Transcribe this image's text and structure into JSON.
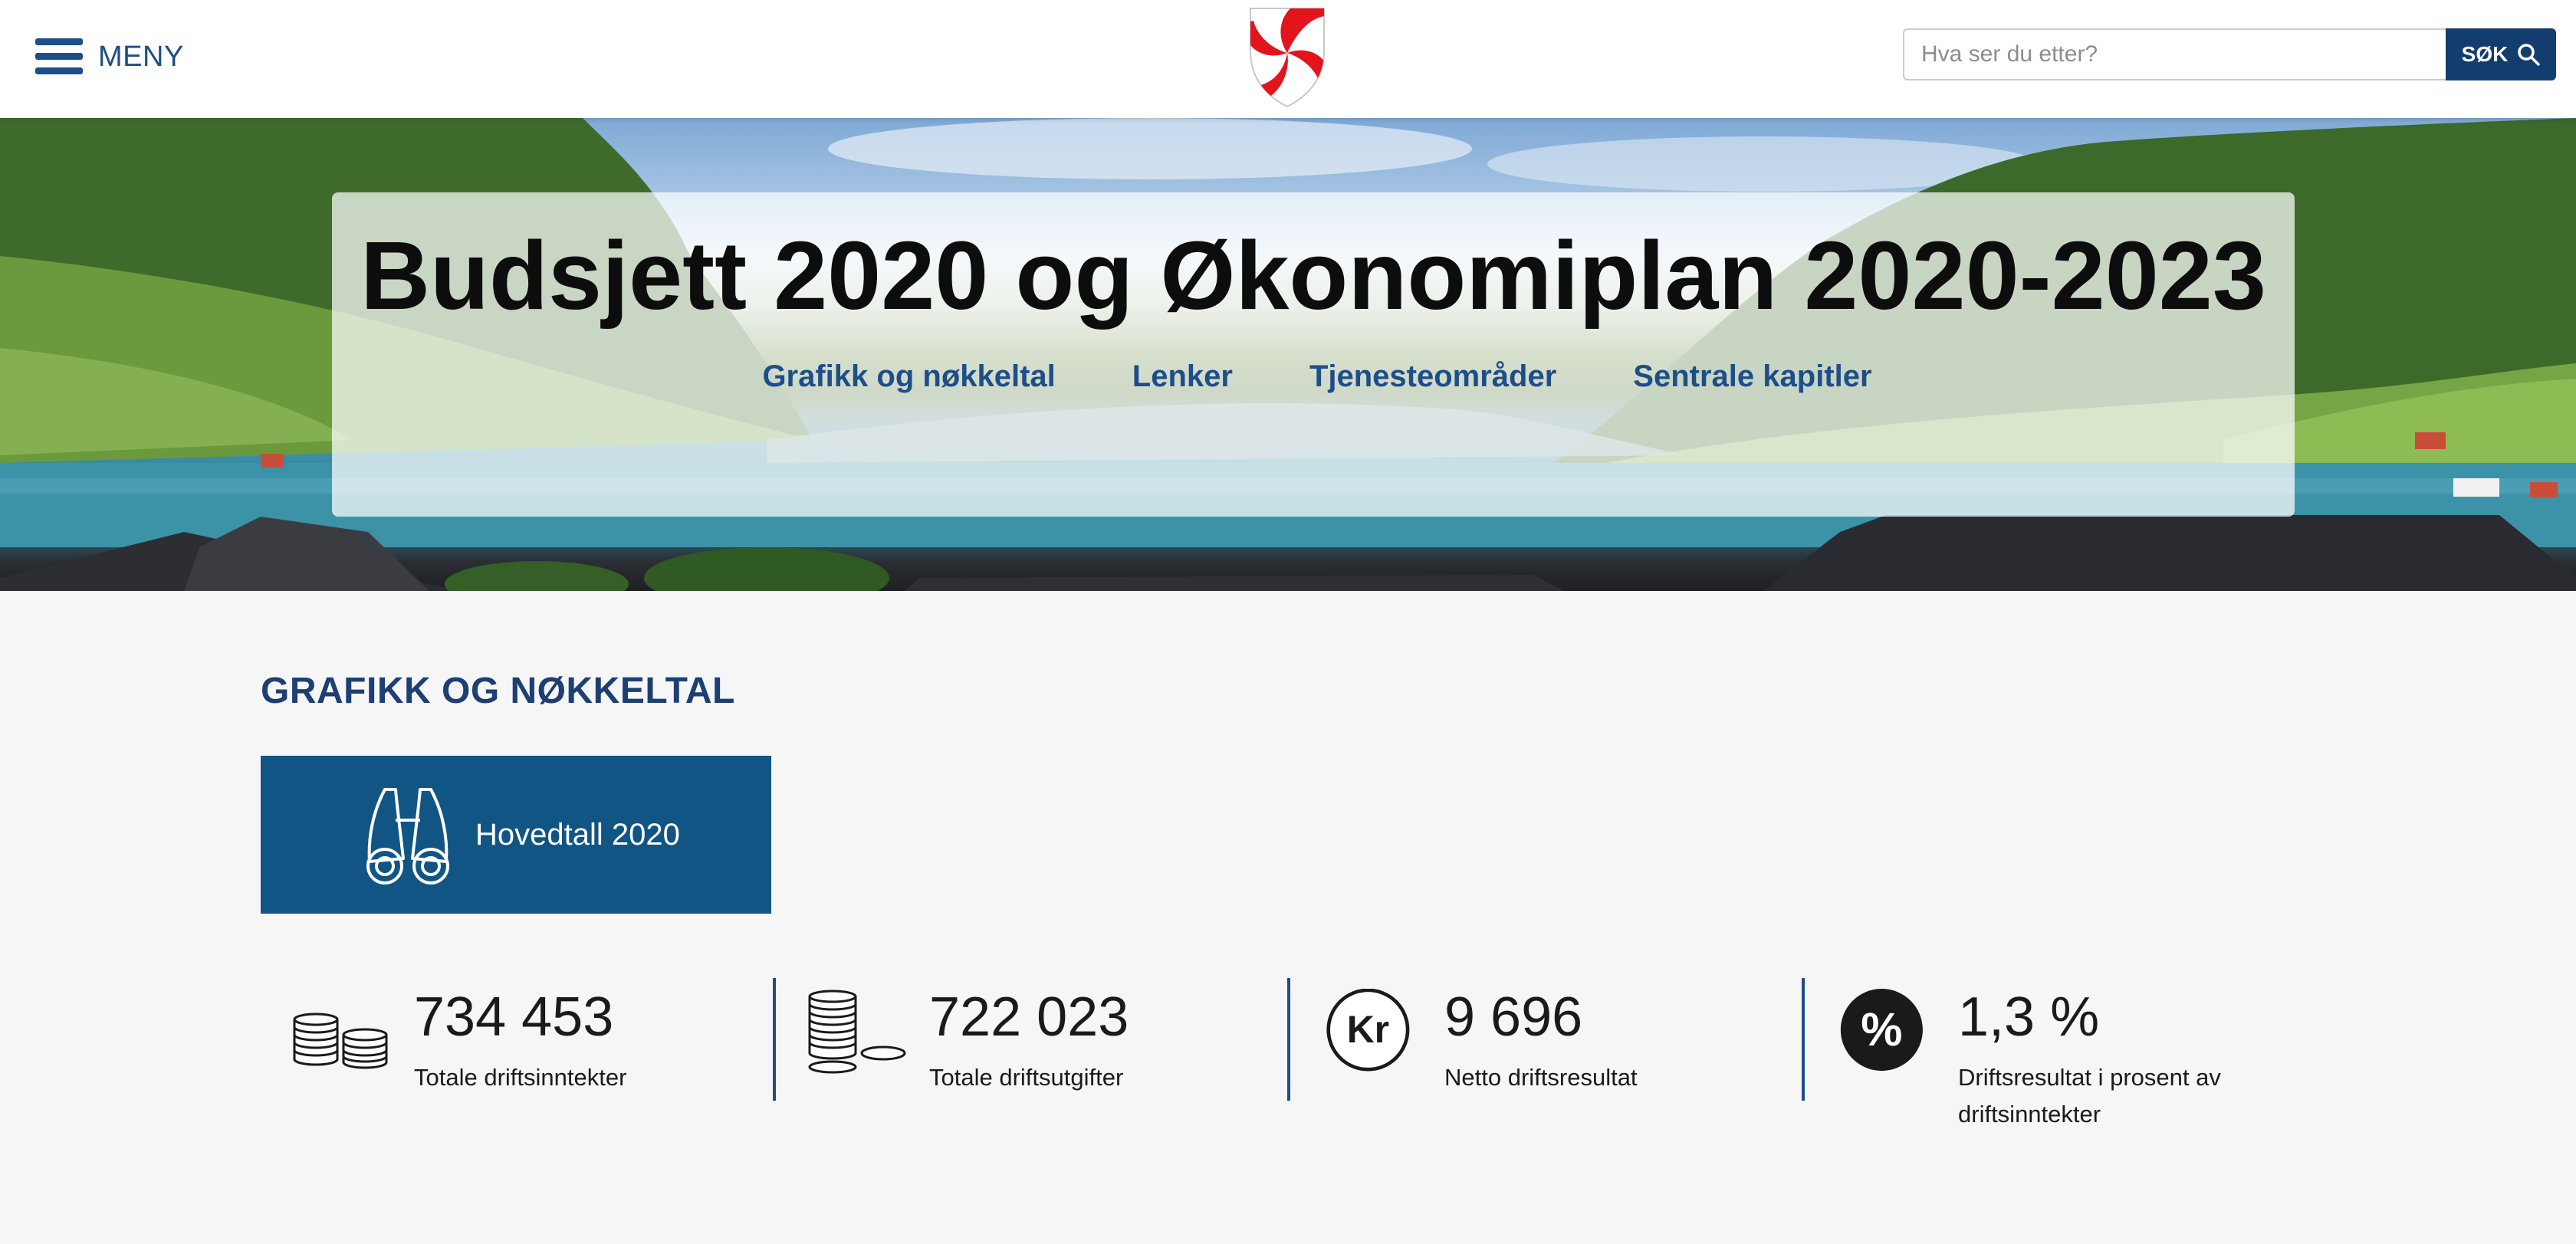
{
  "header": {
    "menu_label": "MENY",
    "search": {
      "placeholder": "Hva ser du etter?",
      "button_label": "SØK"
    }
  },
  "hero": {
    "title": "Budsjett 2020 og Økonomiplan 2020-2023",
    "nav": [
      {
        "label": "Grafikk og nøkkeltal"
      },
      {
        "label": "Lenker"
      },
      {
        "label": "Tjenesteområder"
      },
      {
        "label": "Sentrale kapitler"
      }
    ]
  },
  "main": {
    "section_title": "GRAFIKK OG NØKKELTAL",
    "card": {
      "label": "Hovedtall 2020",
      "icon": "binoculars-icon"
    },
    "stats": [
      {
        "value": "734 453",
        "label": "Totale driftsinntekter",
        "icon": "coins-stack-icon"
      },
      {
        "value": "722 023",
        "label": "Totale driftsutgifter",
        "icon": "coins-spread-icon"
      },
      {
        "value": "9 696",
        "label": "Netto driftsresultat",
        "icon": "kr-icon",
        "icon_text": "Kr"
      },
      {
        "value": "1,3 %",
        "label": "Driftsresultat i prosent av driftsinntekter",
        "icon": "percent-icon",
        "icon_text": "%"
      }
    ]
  },
  "colors": {
    "brand_blue": "#1d4e89",
    "card_blue": "#115585",
    "search_button": "#123d6e",
    "logo_red": "#e3141b"
  }
}
